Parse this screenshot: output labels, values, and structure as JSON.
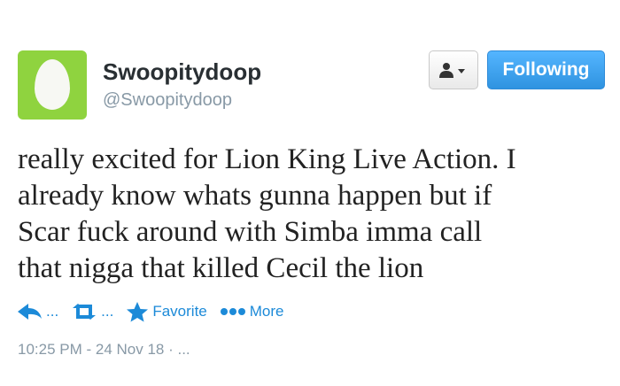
{
  "user": {
    "display_name": "Swoopitydoop",
    "handle": "@Swoopitydoop",
    "avatar_icon": "egg-avatar-icon",
    "avatar_color": "#8fd33f"
  },
  "header": {
    "user_actions_icon": "person-dropdown-icon",
    "follow_label": "Following",
    "follow_color": "#2f93e0"
  },
  "tweet": {
    "lines": [
      "really excited for Lion King Live Action. I",
      "already know whats gunna happen but if",
      "Scar fuck around with Simba imma call",
      "that nigga that killed Cecil the lion"
    ]
  },
  "actions": {
    "reply_label": "...",
    "retweet_label": "...",
    "favorite_label": "Favorite",
    "more_label": "More",
    "accent_color": "#1c8ad8"
  },
  "meta": {
    "timestamp": "10:25 PM - 24 Nov 18 · ..."
  }
}
